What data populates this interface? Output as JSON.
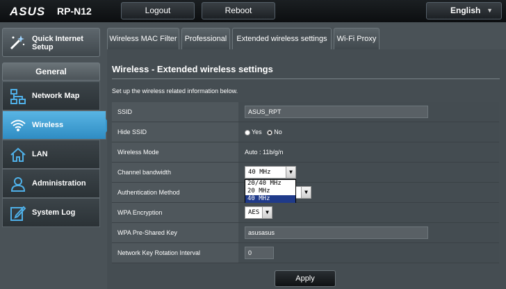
{
  "header": {
    "brand": "ASUS",
    "model": "RP-N12",
    "logout_label": "Logout",
    "reboot_label": "Reboot",
    "language": "English"
  },
  "sidebar": {
    "quick_setup_label": "Quick Internet Setup",
    "section_label": "General",
    "items": [
      {
        "label": "Network Map",
        "icon": "network-map-icon"
      },
      {
        "label": "Wireless",
        "icon": "wifi-icon"
      },
      {
        "label": "LAN",
        "icon": "home-icon"
      },
      {
        "label": "Administration",
        "icon": "user-icon"
      },
      {
        "label": "System Log",
        "icon": "edit-log-icon"
      }
    ]
  },
  "tabs": [
    {
      "label": "Wireless MAC Filter"
    },
    {
      "label": "Professional"
    },
    {
      "label": "Extended wireless settings"
    },
    {
      "label": "Wi-Fi Proxy"
    }
  ],
  "main": {
    "title": "Wireless - Extended wireless settings",
    "description": "Set up the wireless related information below.",
    "fields": {
      "ssid": {
        "label": "SSID",
        "value": "ASUS_RPT"
      },
      "hide_ssid": {
        "label": "Hide SSID",
        "yes": "Yes",
        "no": "No",
        "selected": "No"
      },
      "wireless_mode": {
        "label": "Wireless Mode",
        "value": "Auto : 11b/g/n"
      },
      "channel_bandwidth": {
        "label": "Channel bandwidth",
        "value": "40 MHz",
        "options": [
          "20/40 MHz",
          "20 MHz",
          "40 MHz"
        ]
      },
      "auth_method": {
        "label": "Authentication Method"
      },
      "wpa_encryption": {
        "label": "WPA Encryption",
        "value": "AES"
      },
      "wpa_psk": {
        "label": "WPA Pre-Shared Key",
        "value": "asusasus"
      },
      "key_rotation": {
        "label": "Network Key Rotation Interval",
        "value": "0"
      }
    },
    "apply_label": "Apply"
  },
  "colors": {
    "accent": "#3596cc",
    "background": "#4a5257",
    "topbar": "#0c0e10"
  }
}
